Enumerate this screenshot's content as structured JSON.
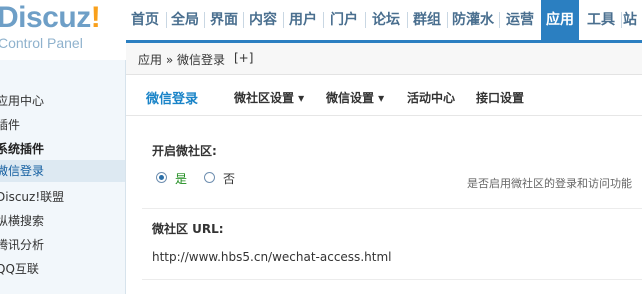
{
  "logo": {
    "main": "Discuz",
    "bang": "!",
    "sub": "Control Panel"
  },
  "topnav": {
    "items": [
      "首页",
      "全局",
      "界面",
      "内容",
      "用户",
      "门户",
      "论坛",
      "群组",
      "防灌水",
      "运营",
      "应用",
      "工具",
      "站"
    ],
    "active_index": 10
  },
  "breadcrumb": {
    "path": "应用 » 微信登录",
    "add": "[+]"
  },
  "sidebar": {
    "items": [
      {
        "label": "应用中心"
      },
      {
        "label": "插件"
      },
      {
        "label": "系统插件"
      },
      {
        "label": "微信登录"
      },
      {
        "label": "Discuz!联盟"
      },
      {
        "label": "纵横搜索"
      },
      {
        "label": "腾讯分析"
      },
      {
        "label": "QQ互联"
      }
    ]
  },
  "tabs": {
    "items": [
      "微信登录",
      "微社区设置 ▾",
      "微信设置 ▾",
      "活动中心",
      "接口设置"
    ]
  },
  "form": {
    "enable_label": "开启微社区:",
    "yes_label": "是",
    "no_label": "否",
    "hint": "是否启用微社区的登录和访问功能",
    "url_label": "微社区 URL:",
    "url_value": "http://www.hbs5.cn/wechat-access.html",
    "selected": "yes"
  },
  "colors": {
    "accent": "#2b7fc1",
    "tab_active": "#1a84c8",
    "logo": "#6e9fc7",
    "logo_bang": "#f9a01b"
  }
}
